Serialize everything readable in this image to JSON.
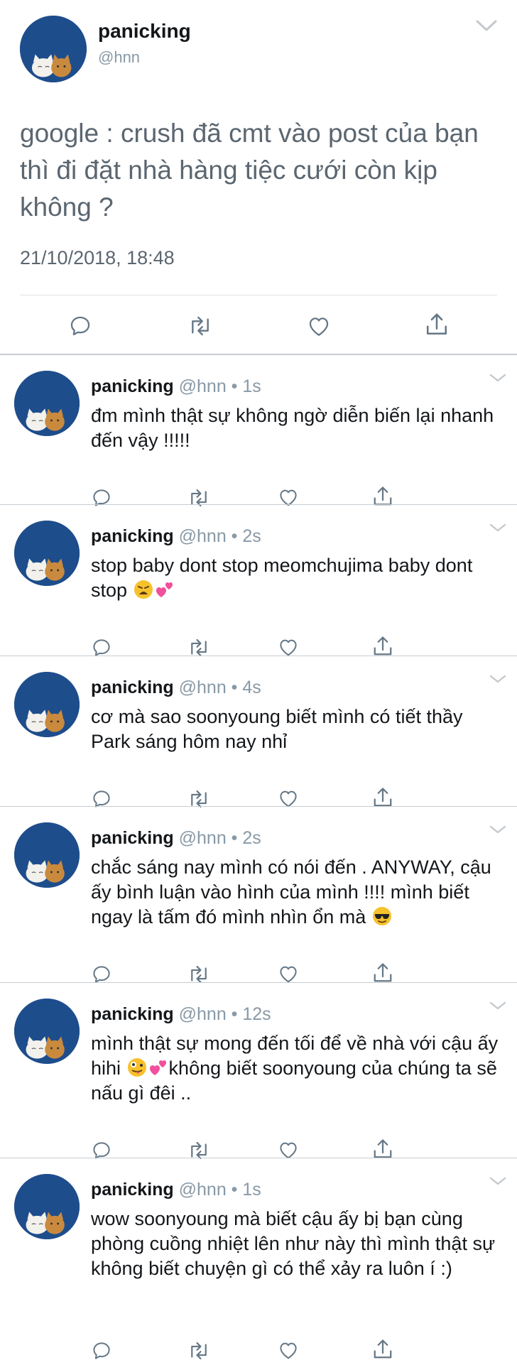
{
  "main_tweet": {
    "name": "panicking",
    "handle": "@hnn",
    "text": "google : crush đã cmt vào post của bạn thì đi đặt nhà hàng tiệc cưới còn kịp không ?",
    "timestamp": "21/10/2018, 18:48"
  },
  "replies": [
    {
      "name": "panicking",
      "meta": "@hnn • 1s",
      "text": "đm mình thật sự không ngờ diễn biến lại nhanh đến vậy !!!!!"
    },
    {
      "name": "panicking",
      "meta": "@hnn • 2s",
      "text": "stop baby dont stop meomchujima baby dont stop"
    },
    {
      "name": "panicking",
      "meta": "@hnn • 4s",
      "text": "cơ mà sao soonyoung biết mình có tiết thầy Park sáng hôm nay nhỉ"
    },
    {
      "name": "panicking",
      "meta": "@hnn • 2s",
      "text": "chắc sáng nay mình có nói đến . ANYWAY, cậu ấy bình luận vào hình của mình !!!! mình biết ngay là tấm đó mình nhìn ổn mà"
    },
    {
      "name": "panicking",
      "meta": "@hnn • 12s",
      "text_a": "mình thật sự mong đến tối để về nhà với cậu ấy hihi",
      "text_b": "không biết soonyoung của chúng ta sẽ nấu gì đêi .."
    },
    {
      "name": "panicking",
      "meta": "@hnn • 1s",
      "text": "wow soonyoung mà biết cậu ấy bị bạn cùng phòng cuồng nhiệt lên như này thì mình thật sự không biết chuyện gì có thể xảy ra luôn í :)"
    }
  ],
  "icons": {
    "reply": "reply-icon",
    "retweet": "retweet-icon",
    "like": "heart-icon",
    "share": "share-icon",
    "caret": "chevron-down-icon"
  },
  "colors": {
    "avatar_bg": "#1e4d8c",
    "handle_gray": "#8899a6",
    "icon_gray": "#657786"
  }
}
